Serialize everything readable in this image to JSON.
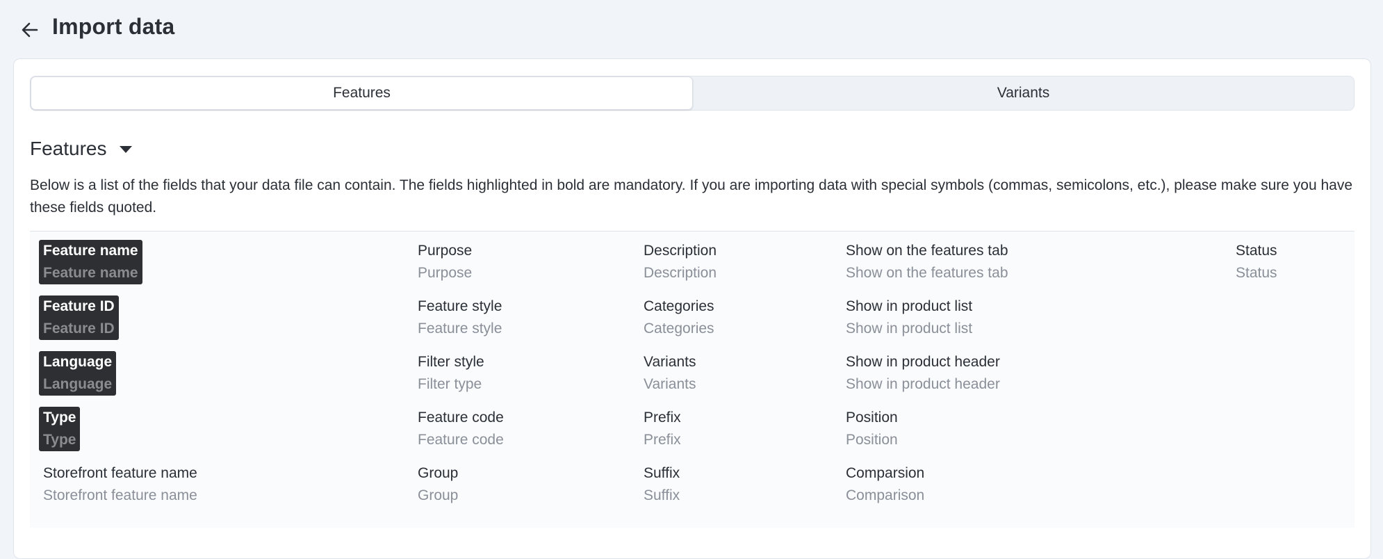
{
  "header": {
    "title": "Import data",
    "back_icon": "arrow-left-icon"
  },
  "tabs": [
    {
      "label": "Features",
      "active": true
    },
    {
      "label": "Variants",
      "active": false
    }
  ],
  "section": {
    "title": "Features",
    "description": "Below is a list of the fields that your data file can contain. The fields highlighted in bold are mandatory. If you are importing data with special symbols (commas, semicolons, etc.), please make sure you have these fields quoted."
  },
  "fields": {
    "col1": [
      {
        "name": "Feature name",
        "sub": "Feature name",
        "required": true
      },
      {
        "name": "Feature ID",
        "sub": "Feature ID",
        "required": true
      },
      {
        "name": "Language",
        "sub": "Language",
        "required": true
      },
      {
        "name": "Type",
        "sub": "Type",
        "required": true
      },
      {
        "name": "Storefront feature name",
        "sub": "Storefront feature name",
        "required": false
      }
    ],
    "col2": [
      {
        "name": "Purpose",
        "sub": "Purpose"
      },
      {
        "name": "Feature style",
        "sub": "Feature style"
      },
      {
        "name": "Filter style",
        "sub": "Filter type"
      },
      {
        "name": "Feature code",
        "sub": "Feature code"
      },
      {
        "name": "Group",
        "sub": "Group"
      }
    ],
    "col3": [
      {
        "name": "Description",
        "sub": "Description"
      },
      {
        "name": "Categories",
        "sub": "Categories"
      },
      {
        "name": "Variants",
        "sub": "Variants"
      },
      {
        "name": "Prefix",
        "sub": "Prefix"
      },
      {
        "name": "Suffix",
        "sub": "Suffix"
      }
    ],
    "col4": [
      {
        "name": "Show on the features tab",
        "sub": "Show on the features tab"
      },
      {
        "name": "Show in product list",
        "sub": "Show in product list"
      },
      {
        "name": "Show in product header",
        "sub": "Show in product header"
      },
      {
        "name": "Position",
        "sub": "Position"
      },
      {
        "name": "Comparsion",
        "sub": "Comparison"
      }
    ],
    "col5": [
      {
        "name": "Status",
        "sub": "Status"
      }
    ]
  }
}
